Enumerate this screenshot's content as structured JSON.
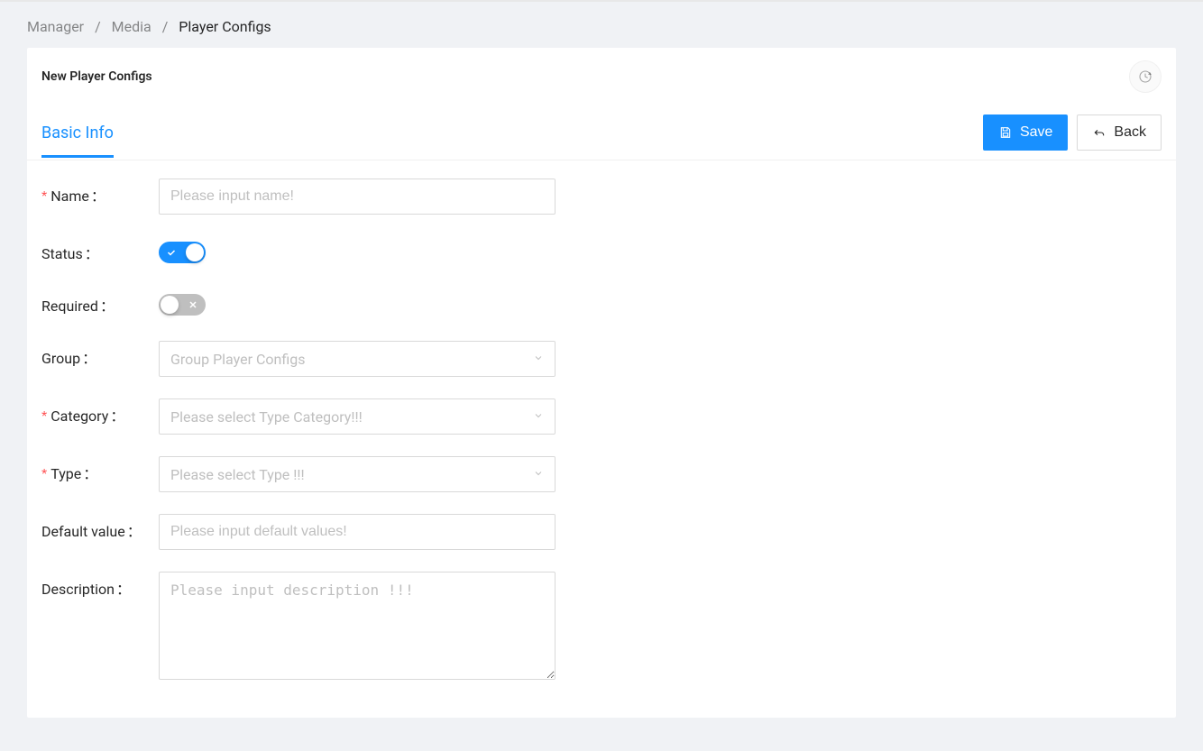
{
  "breadcrumb": {
    "manager": "Manager",
    "media": "Media",
    "current": "Player Configs"
  },
  "card": {
    "title": "New Player Configs"
  },
  "tabs": {
    "basic_info": "Basic Info"
  },
  "buttons": {
    "save": "Save",
    "back": "Back"
  },
  "form": {
    "name": {
      "label": "Name",
      "placeholder": "Please input name!",
      "required": true
    },
    "status": {
      "label": "Status",
      "value": true
    },
    "required": {
      "label": "Required",
      "value": false
    },
    "group": {
      "label": "Group",
      "placeholder": "Group Player Configs"
    },
    "category": {
      "label": "Category",
      "placeholder": "Please select Type Category!!!",
      "required": true
    },
    "type": {
      "label": "Type",
      "placeholder": "Please select Type !!!",
      "required": true
    },
    "default_value": {
      "label": "Default value",
      "placeholder": "Please input default values!"
    },
    "description": {
      "label": "Description",
      "placeholder": "Please input description !!!"
    }
  },
  "punct": {
    "colon": "："
  }
}
